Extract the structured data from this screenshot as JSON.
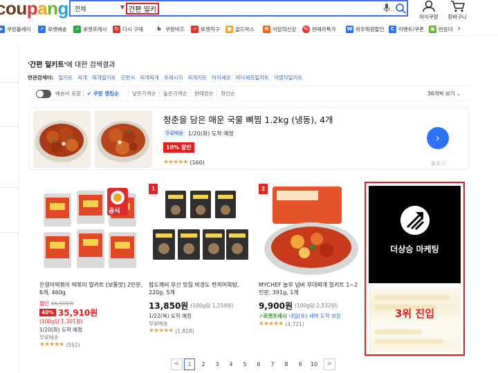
{
  "header": {
    "logo": [
      "cou",
      "p",
      "a",
      "n",
      "g"
    ],
    "category_select": "전체",
    "search_value": "간편 밀키트",
    "my_coupang": "마이쿠팡",
    "cart": "장바구니"
  },
  "category_nav": [
    {
      "label": "쿠팡플레이",
      "icon": "play-icon",
      "color": "#2b73ff"
    },
    {
      "label": "로켓배송",
      "icon": "rocket-icon",
      "color": "#2b73ff"
    },
    {
      "label": "로켓프레시",
      "icon": "rocket-fresh-icon",
      "color": "#28a745"
    },
    {
      "label": "다시 구매",
      "icon": "rebuy-icon",
      "color": "#e8312f"
    },
    {
      "label": "쿠팡비즈",
      "icon": "biz-icon",
      "color": "#111111"
    },
    {
      "label": "로켓직구",
      "icon": "global-rocket-icon",
      "color": "#e8312f"
    },
    {
      "label": "골드박스",
      "icon": "goldbox-icon",
      "color": "#f4a51c"
    },
    {
      "label": "이달의신상",
      "icon": "new-item-icon",
      "color": "#f46a1c"
    },
    {
      "label": "판매자특가",
      "icon": "percent-icon",
      "color": "#e8312f"
    },
    {
      "label": "위우뭐원할인",
      "icon": "wow-icon",
      "color": "#2b73ff"
    },
    {
      "label": "이벤트/쿠폰",
      "icon": "coupon-icon",
      "color": "#2b73ff"
    },
    {
      "label": "반응더",
      "icon": "gift-icon",
      "color": "#69b62d"
    }
  ],
  "results": {
    "query_label": "'간편 밀키트'",
    "suffix": "에 대한 검색결과",
    "related_label": "연관검색어:",
    "related": [
      "밀키트",
      "찌개",
      "찌개밀키트",
      "간편식",
      "찌개찌개",
      "프레시지",
      "찌개키트",
      "마이셰프",
      "마이셰프밀키트",
      "이영자밀키트"
    ]
  },
  "filters": {
    "free_shipping": "배송비 포함",
    "sorts": [
      "쿠팡 랭킹순",
      "낮은가격순",
      "높은가격순",
      "판매량순",
      "최신순"
    ],
    "view_count": "36개씩 보기"
  },
  "ad": {
    "title": "청춘을 담은 매운 국물 뼈찜 1.2kg (냉동), 4개",
    "shipping_badge": "무료배송",
    "arrival": "1/20(화) 도착 예정",
    "discount": "10% 할인",
    "stars": "★★★★★",
    "reviews": "(160)",
    "ad_label": "광고"
  },
  "products": [
    {
      "rank": "",
      "badge": "공식",
      "name": "은영이떡볶이 떡볶이 밀키트 [보통맛] 2인분, 6개, 460g",
      "discount_label": "할인",
      "orig_price": "66,500원",
      "discount_pct": "40%",
      "price": "35,910원",
      "unit_price": "(100g당 1,301원)",
      "arrival": "1/20(화) 도착 예정",
      "shipping": "무료배송",
      "stars": "★★★★★",
      "reviews": "(552)"
    },
    {
      "rank": "1",
      "name": "참도깨비 부산 맛집 박경도 한끼어묵탕, 220g, 5개",
      "price": "13,850원",
      "unit_price": "(100g당 1,259원)",
      "arrival": "1/22(목) 도착 예정",
      "shipping": "무료배송",
      "stars": "★★★★★",
      "reviews": "(1,818)"
    },
    {
      "rank": "2",
      "name": "MYCHEF 놀부 넘버 부대찌개 밀키트 1~2인분, 391g, 1개",
      "price": "9,900원",
      "unit_price": "(100g당 2,532원)",
      "rocket": "로켓프레시",
      "arrival": "내일(토) 새벽 도착 보장",
      "stars": "★★★★★",
      "reviews": "(4,721)"
    }
  ],
  "marketing": {
    "brand": "더상승 마케팅",
    "rank_text": "3위 진입"
  },
  "pagination": {
    "prev": "<",
    "pages": [
      "1",
      "2",
      "3",
      "4",
      "5",
      "6",
      "7",
      "8",
      "9",
      "10"
    ],
    "current": "1",
    "next": ">"
  },
  "colors": {
    "accent_blue": "#2b73ff",
    "sale_red": "#e41e1e",
    "highlight_border": "#e21c1c"
  }
}
